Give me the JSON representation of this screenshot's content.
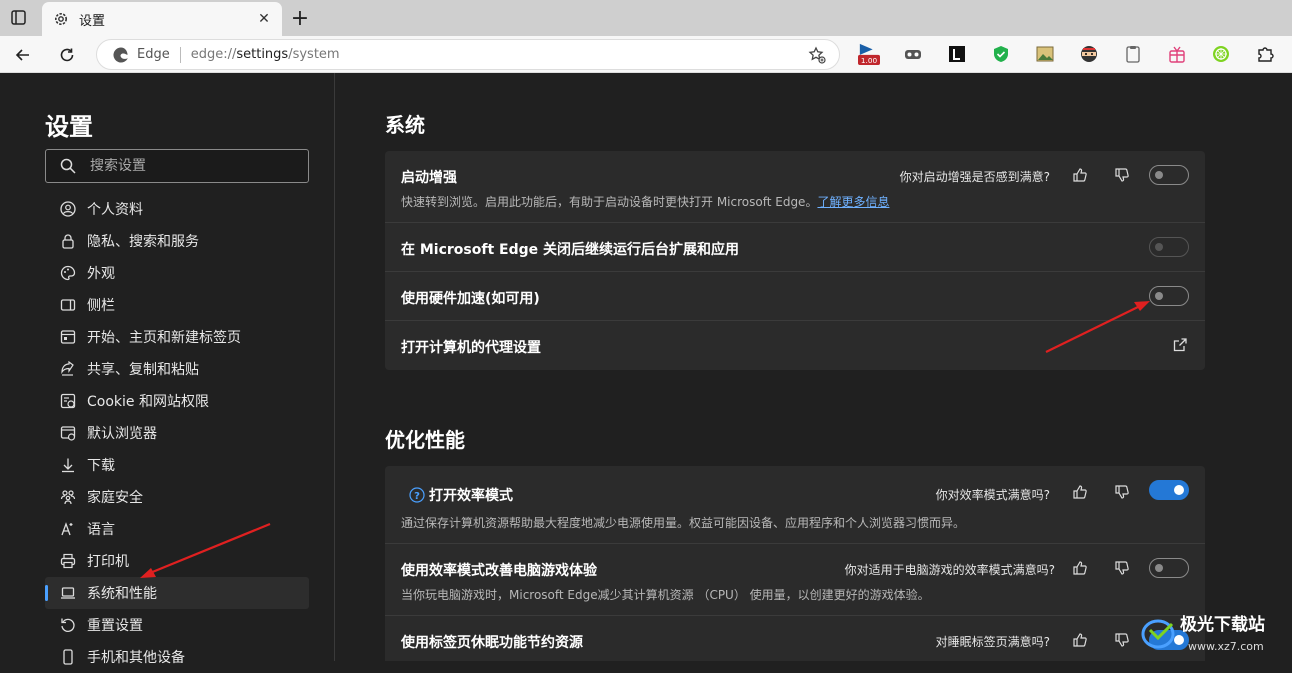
{
  "browser": {
    "tab_title": "设置",
    "tab_close": "✕",
    "new_tab": "+",
    "omnibox": {
      "site_label": "Edge",
      "url_prefix": "edge://",
      "url_host": "settings",
      "url_path": "/system"
    },
    "extension_badge": "1.00"
  },
  "sidebar": {
    "title": "设置",
    "search_placeholder": "搜索设置",
    "items": [
      {
        "label": "个人资料",
        "icon": "profile-icon"
      },
      {
        "label": "隐私、搜索和服务",
        "icon": "lock-icon"
      },
      {
        "label": "外观",
        "icon": "palette-icon"
      },
      {
        "label": "侧栏",
        "icon": "sidebar-icon"
      },
      {
        "label": "开始、主页和新建标签页",
        "icon": "home-tabs-icon"
      },
      {
        "label": "共享、复制和粘贴",
        "icon": "share-icon"
      },
      {
        "label": "Cookie 和网站权限",
        "icon": "cookie-icon"
      },
      {
        "label": "默认浏览器",
        "icon": "browser-icon"
      },
      {
        "label": "下载",
        "icon": "download-icon"
      },
      {
        "label": "家庭安全",
        "icon": "family-icon"
      },
      {
        "label": "语言",
        "icon": "language-icon"
      },
      {
        "label": "打印机",
        "icon": "printer-icon"
      },
      {
        "label": "系统和性能",
        "icon": "laptop-icon",
        "active": true
      },
      {
        "label": "重置设置",
        "icon": "reset-icon"
      },
      {
        "label": "手机和其他设备",
        "icon": "phone-icon"
      }
    ]
  },
  "main": {
    "system": {
      "title": "系统",
      "rows": [
        {
          "title": "启动增强",
          "desc": "快速转到浏览。启用此功能后，有助于启动设备时更快打开 Microsoft Edge。",
          "link": "了解更多信息",
          "question": "你对启动增强是否感到满意?",
          "toggle": "off"
        },
        {
          "title": "在 Microsoft Edge 关闭后继续运行后台扩展和应用",
          "toggle": "off-disabled"
        },
        {
          "title": "使用硬件加速(如可用)",
          "toggle": "off"
        },
        {
          "title": "打开计算机的代理设置",
          "action": "external-link"
        }
      ]
    },
    "performance": {
      "title": "优化性能",
      "rows": [
        {
          "title": "打开效率模式",
          "desc": "通过保存计算机资源帮助最大程度地减少电源使用量。权益可能因设备、应用程序和个人浏览器习惯而异。",
          "question": "你对效率模式满意吗?",
          "toggle": "on"
        },
        {
          "title": "使用效率模式改善电脑游戏体验",
          "desc": "当你玩电脑游戏时，Microsoft Edge减少其计算机资源 （CPU） 使用量，以创建更好的游戏体验。",
          "question": "你对适用于电脑游戏的效率模式满意吗?",
          "toggle": "off"
        },
        {
          "title": "使用标签页休眠功能节约资源",
          "question": "对睡眠标签页满意吗?",
          "toggle": "on"
        }
      ]
    }
  },
  "watermark": {
    "text": "极光下载站",
    "sub": "www.xz7.com"
  },
  "colors": {
    "accent": "#2478d6",
    "annotation_arrow": "#e02020"
  }
}
